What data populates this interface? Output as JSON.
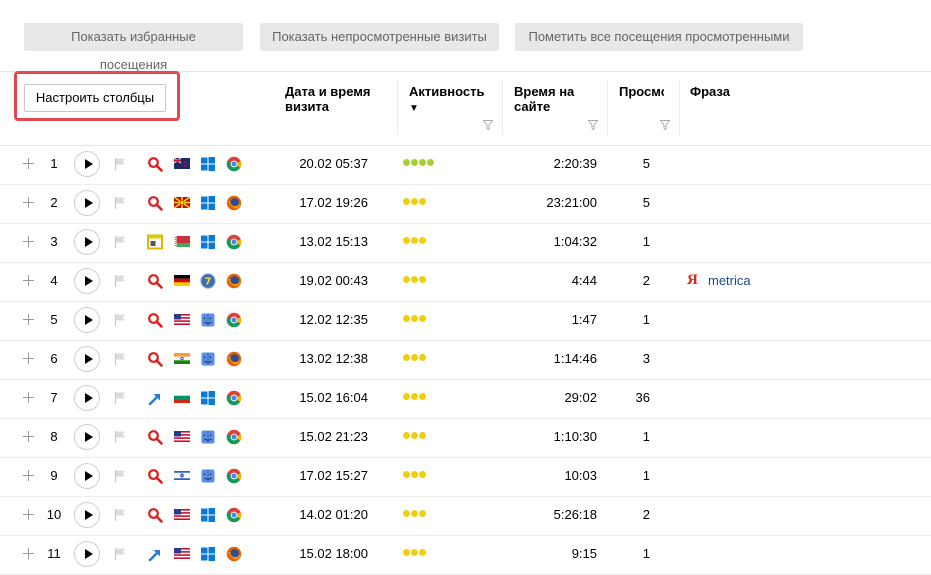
{
  "toolbar": {
    "show_favorites": "Показать избранные посещения",
    "show_unviewed": "Показать непросмотренные визиты",
    "mark_all_viewed": "Пометить все посещения просмотренными"
  },
  "configure_columns": "Настроить столбцы",
  "columns": {
    "date": "Дата и время визита",
    "activity": "Активность",
    "sort_indicator": "▼",
    "time_on_site": "Время на сайте",
    "views": "Просмо",
    "phrase": "Фраза"
  },
  "colors": {
    "accent_frame": "#e34850",
    "dot_green": "#a8d12f",
    "dot_yellow": "#f3ce0a",
    "phrase_link": "#1a4a8c"
  },
  "rows": [
    {
      "num": "1",
      "source": "search-icon",
      "flag": "new-zealand",
      "os": "windows",
      "browser": "chrome",
      "date": "20.02 05:37",
      "activity": 4,
      "activity_color": "green",
      "duration": "2:20:39",
      "views": "5",
      "phrase": ""
    },
    {
      "num": "2",
      "source": "search-icon",
      "flag": "macedonia",
      "os": "windows",
      "browser": "firefox",
      "date": "17.02 19:26",
      "activity": 3,
      "activity_color": "yellow",
      "duration": "23:21:00",
      "views": "5",
      "phrase": ""
    },
    {
      "num": "3",
      "source": "window-icon",
      "flag": "belarus",
      "os": "windows",
      "browser": "chrome",
      "date": "13.02 15:13",
      "activity": 3,
      "activity_color": "yellow",
      "duration": "1:04:32",
      "views": "1",
      "phrase": ""
    },
    {
      "num": "4",
      "source": "search-icon",
      "flag": "germany",
      "os": "windows-7",
      "browser": "firefox",
      "date": "19.02 00:43",
      "activity": 3,
      "activity_color": "yellow",
      "duration": "4:44",
      "views": "2",
      "phrase": "metrica",
      "phrase_engine": "Я"
    },
    {
      "num": "5",
      "source": "search-icon",
      "flag": "usa",
      "os": "mac",
      "browser": "chrome",
      "date": "12.02 12:35",
      "activity": 3,
      "activity_color": "yellow",
      "duration": "1:47",
      "views": "1",
      "phrase": ""
    },
    {
      "num": "6",
      "source": "search-icon",
      "flag": "india",
      "os": "mac",
      "browser": "firefox",
      "date": "13.02 12:38",
      "activity": 3,
      "activity_color": "yellow",
      "duration": "1:14:46",
      "views": "3",
      "phrase": ""
    },
    {
      "num": "7",
      "source": "link-arrow-icon",
      "flag": "bulgaria",
      "os": "windows",
      "browser": "chrome",
      "date": "15.02 16:04",
      "activity": 3,
      "activity_color": "yellow",
      "duration": "29:02",
      "views": "36",
      "phrase": ""
    },
    {
      "num": "8",
      "source": "search-icon",
      "flag": "usa",
      "os": "mac",
      "browser": "chrome",
      "date": "15.02 21:23",
      "activity": 3,
      "activity_color": "yellow",
      "duration": "1:10:30",
      "views": "1",
      "phrase": ""
    },
    {
      "num": "9",
      "source": "search-icon",
      "flag": "israel",
      "os": "mac",
      "browser": "chrome",
      "date": "17.02 15:27",
      "activity": 3,
      "activity_color": "yellow",
      "duration": "10:03",
      "views": "1",
      "phrase": ""
    },
    {
      "num": "10",
      "source": "search-icon",
      "flag": "usa",
      "os": "windows",
      "browser": "chrome",
      "date": "14.02 01:20",
      "activity": 3,
      "activity_color": "yellow",
      "duration": "5:26:18",
      "views": "2",
      "phrase": ""
    },
    {
      "num": "11",
      "source": "link-arrow-icon",
      "flag": "usa",
      "os": "windows",
      "browser": "firefox",
      "date": "15.02 18:00",
      "activity": 3,
      "activity_color": "yellow",
      "duration": "9:15",
      "views": "1",
      "phrase": ""
    }
  ]
}
